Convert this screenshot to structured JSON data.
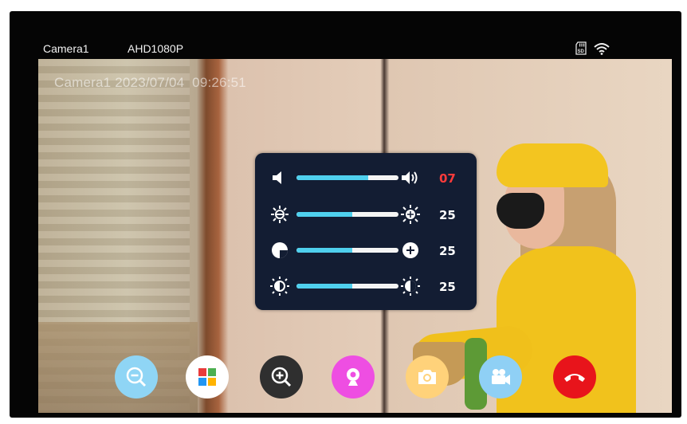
{
  "header": {
    "camera_name": "Camera1",
    "resolution": "AHD1080P",
    "icons": [
      "sd-card-icon",
      "wifi-icon"
    ]
  },
  "video": {
    "osd_overlay": "Camera1 2023/07/04  09:26:51"
  },
  "settings_panel": {
    "rows": [
      {
        "name": "volume",
        "value": "07",
        "level": 0.7,
        "value_color": "#ff3b3b",
        "icon_left": "volume-low-icon",
        "icon_right": "volume-high-icon"
      },
      {
        "name": "brightness",
        "value": "25",
        "level": 0.55,
        "value_color": "#ffffff",
        "icon_left": "brightness-low-icon",
        "icon_right": "brightness-high-icon"
      },
      {
        "name": "contrast",
        "value": "25",
        "level": 0.55,
        "value_color": "#ffffff",
        "icon_left": "contrast-low-icon",
        "icon_right": "contrast-high-icon"
      },
      {
        "name": "saturation",
        "value": "25",
        "level": 0.55,
        "value_color": "#ffffff",
        "icon_left": "saturation-low-icon",
        "icon_right": "saturation-high-icon"
      }
    ]
  },
  "toolbar": {
    "buttons": [
      {
        "name": "zoom-out",
        "icon": "zoom-out-icon",
        "color": "#8fd5f5"
      },
      {
        "name": "menu",
        "icon": "grid-menu-icon",
        "color": "#ffffff"
      },
      {
        "name": "zoom-in",
        "icon": "zoom-in-icon",
        "color": "#2f2f2f"
      },
      {
        "name": "monitor",
        "icon": "webcam-icon",
        "color": "#ee4ee2"
      },
      {
        "name": "snapshot",
        "icon": "camera-icon",
        "color": "#ffd27a"
      },
      {
        "name": "record",
        "icon": "video-camera-icon",
        "color": "#8fd0f5"
      },
      {
        "name": "hang-up",
        "icon": "phone-hangup-icon",
        "color": "#e8141b"
      }
    ]
  }
}
